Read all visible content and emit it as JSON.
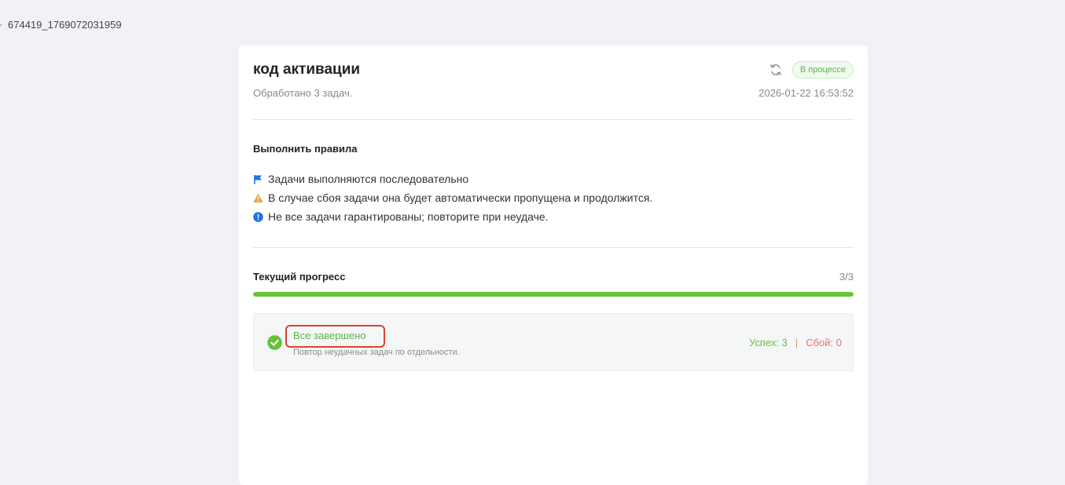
{
  "page": {
    "id_text": "674419_1769072031959"
  },
  "header": {
    "title": "код активации",
    "subtitle": "Обработано 3 задач.",
    "status_badge": "В процессе",
    "timestamp": "2026-01-22 16:53:52"
  },
  "rules": {
    "title": "Выполнить правила",
    "items": [
      {
        "icon": "flag-icon",
        "text": "Задачи выполняются последовательно"
      },
      {
        "icon": "warning-icon",
        "text": "В случае сбоя задачи она будет автоматически пропущена и продолжится."
      },
      {
        "icon": "info-icon",
        "text": "Не все задачи гарантированы; повторите при неудаче."
      }
    ]
  },
  "progress": {
    "title": "Текущий прогресс",
    "count": "3/3",
    "fraction": 1.0
  },
  "result": {
    "title": "Все завершено",
    "subtitle": "Повтор неудачных задач по отдельности.",
    "success_label": "Успех: 3",
    "separator": "|",
    "fail_label": "Сбой: 0"
  },
  "colors": {
    "success": "#67c23a",
    "fail": "#f56c6c",
    "flag": "#1a73e8",
    "warning": "#e6a23c",
    "info": "#1a73e8",
    "highlight": "#d8432c"
  }
}
